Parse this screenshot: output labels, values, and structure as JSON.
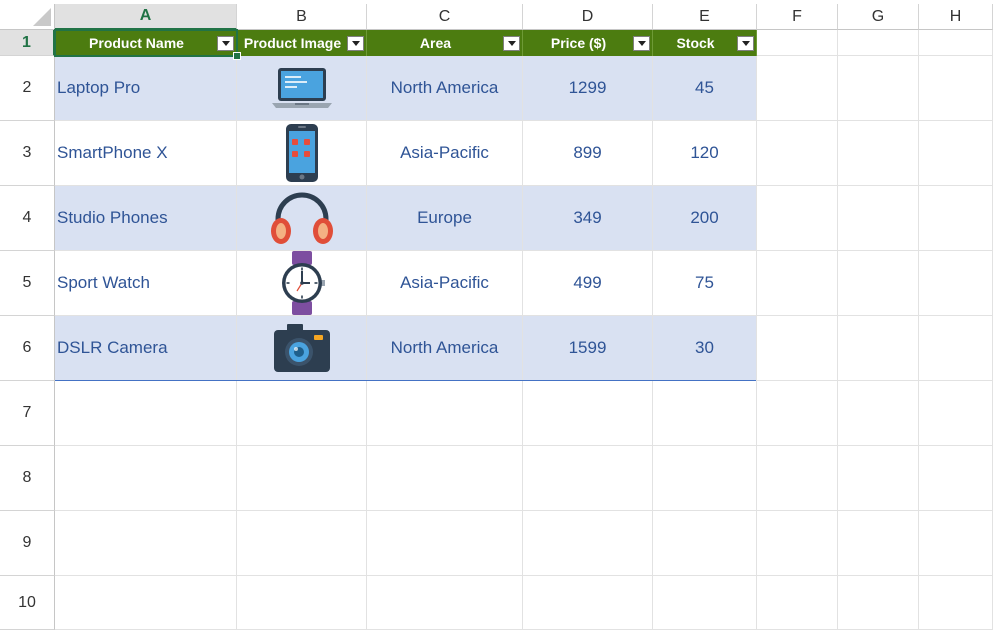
{
  "columns": [
    "A",
    "B",
    "C",
    "D",
    "E",
    "F",
    "G",
    "H"
  ],
  "rows": [
    "1",
    "2",
    "3",
    "4",
    "5",
    "6",
    "7",
    "8",
    "9",
    "10"
  ],
  "table": {
    "headers": [
      "Product Name",
      "Product Image",
      "Area",
      "Price ($)",
      "Stock"
    ],
    "records": [
      {
        "name": "Laptop Pro",
        "image": "laptop-icon",
        "area": "North America",
        "price": "1299",
        "stock": "45"
      },
      {
        "name": "SmartPhone X",
        "image": "smartphone-icon",
        "area": "Asia-Pacific",
        "price": "899",
        "stock": "120"
      },
      {
        "name": "Studio Phones",
        "image": "headphones-icon",
        "area": "Europe",
        "price": "349",
        "stock": "200"
      },
      {
        "name": "Sport Watch",
        "image": "watch-icon",
        "area": "Asia-Pacific",
        "price": "499",
        "stock": "75"
      },
      {
        "name": "DSLR Camera",
        "image": "camera-icon",
        "area": "North America",
        "price": "1599",
        "stock": "30"
      }
    ]
  },
  "colors": {
    "header_fill": "#4c7c10",
    "band_fill": "#d9e1f2",
    "text": "#2f5496",
    "selection": "#217346"
  }
}
